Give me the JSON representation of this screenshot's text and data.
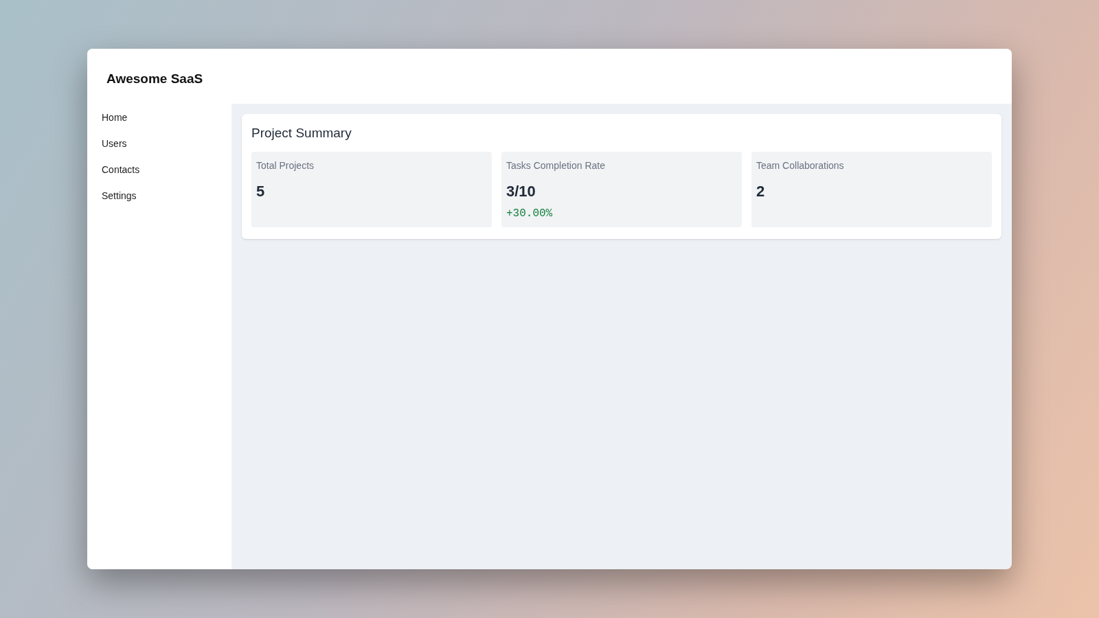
{
  "sidebar": {
    "brand": "Awesome SaaS",
    "items": [
      {
        "label": "Home"
      },
      {
        "label": "Users"
      },
      {
        "label": "Contacts"
      },
      {
        "label": "Settings"
      }
    ]
  },
  "summary": {
    "title": "Project Summary",
    "stats": [
      {
        "label": "Total Projects",
        "value": "5"
      },
      {
        "label": "Tasks Completion Rate",
        "value": "3/10",
        "change": "+30.00%"
      },
      {
        "label": "Team Collaborations",
        "value": "2"
      }
    ]
  }
}
